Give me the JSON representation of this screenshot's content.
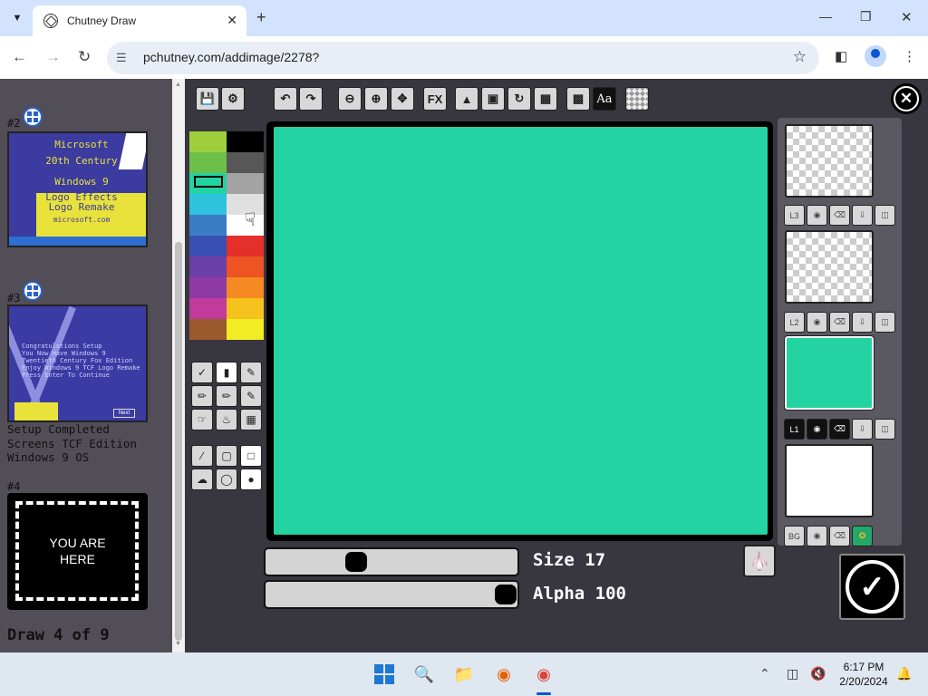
{
  "browser": {
    "tab_title": "Chutney Draw",
    "url": "pchutney.com/addimage/2278?"
  },
  "sidebar": {
    "items": [
      {
        "number": "#2",
        "thumb_lines": [
          "Microsoft",
          "20th Century",
          "Windows 9",
          "Logo Effects",
          "Logo Remake",
          "microsoft.com"
        ]
      },
      {
        "number": "#3",
        "thumb_text": "Congratulations Setup\nYou Now Have Windows 9\nTwentieth Century Fox Edition\nEnjoy Windows 9 TCF Logo Remake\nPress Enter To Continue",
        "next_label": "Next",
        "caption_lines": [
          "Setup Completed",
          "Screens TCF Edition",
          "Windows 9 OS"
        ]
      },
      {
        "number": "#4",
        "placeholder_lines": [
          "YOU ARE",
          "HERE"
        ]
      }
    ],
    "footer": "Draw 4 of 9"
  },
  "toolbar": {
    "fx_label": "FX",
    "text_label": "Aa"
  },
  "palette": {
    "colors": [
      "#9fcf3c",
      "#000000",
      "#6cc04a",
      "#575757",
      "#24d3a2",
      "#a3a3a3",
      "#2fc2dc",
      "#e0e0e0",
      "#3b7dc4",
      "#ffffff",
      "#3a4fb4",
      "#e42f2a",
      "#6b3fa8",
      "#ee5323",
      "#8d3aa6",
      "#f58a23",
      "#c23a9a",
      "#f6c21d",
      "#9a5a2e",
      "#f2ec22"
    ]
  },
  "layers": {
    "labels": [
      "L3",
      "L2",
      "L1",
      "BG"
    ],
    "selected": "L1"
  },
  "sliders": {
    "size_label": "Size 17",
    "size_value": 17,
    "alpha_label": "Alpha 100",
    "alpha_value": 100
  },
  "canvas_color": "#24d3a2",
  "taskbar": {
    "time": "6:17 PM",
    "date": "2/20/2024"
  }
}
